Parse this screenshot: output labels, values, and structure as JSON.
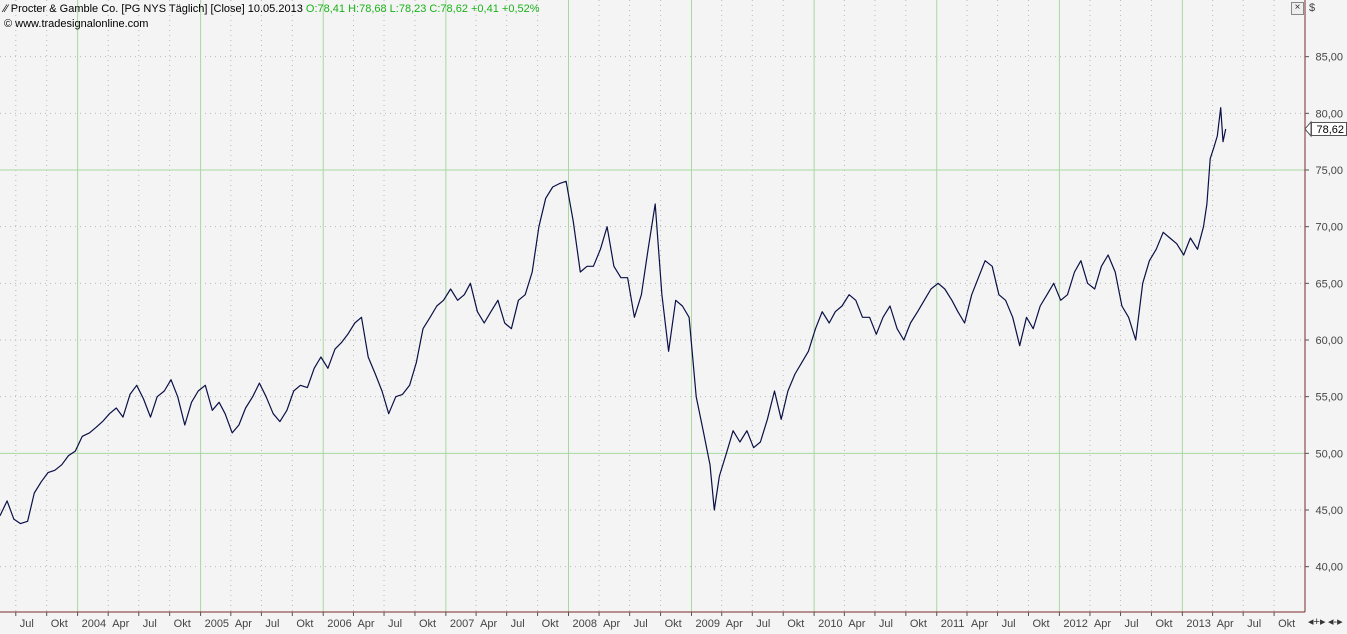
{
  "header": {
    "name": "Procter & Gamble Co.",
    "bracket": "[PG NYS  Täglich] [Close]",
    "date": "10.05.2013",
    "ohlc": "O:78,41 H:78,68 L:78,23 C:78,62 +0,41 +0,52%",
    "source": "www.tradesignalonline.com"
  },
  "close_symbol": "×",
  "nav_symbols": [
    "◂+▸",
    "◂-▸"
  ],
  "colors": {
    "line": "#0b1046",
    "grid_major": "#a8d8a0",
    "grid_minor": "#b8b8b8",
    "background": "#f4f4f4",
    "axis_text": "#444444",
    "up": "#19b219"
  },
  "chart_data": {
    "type": "line",
    "title": "",
    "xlabel": "",
    "ylabel": "$",
    "ylim": [
      36,
      90
    ],
    "yticks": [
      40,
      45,
      50,
      55,
      60,
      65,
      70,
      75,
      80,
      85
    ],
    "ytick_labels": [
      "40,00",
      "45,00",
      "50,00",
      "55,00",
      "60,00",
      "65,00",
      "70,00",
      "75,00",
      "80,00",
      "85,00"
    ],
    "xlim": [
      "2003-05-15",
      "2014-01-01"
    ],
    "xticks": [
      {
        "date": "2003-07-01",
        "label": "Jul"
      },
      {
        "date": "2003-10-01",
        "label": "Okt"
      },
      {
        "date": "2004-01-01",
        "label": "2004",
        "major": true
      },
      {
        "date": "2004-04-01",
        "label": "Apr"
      },
      {
        "date": "2004-07-01",
        "label": "Jul"
      },
      {
        "date": "2004-10-01",
        "label": "Okt"
      },
      {
        "date": "2005-01-01",
        "label": "2005",
        "major": true
      },
      {
        "date": "2005-04-01",
        "label": "Apr"
      },
      {
        "date": "2005-07-01",
        "label": "Jul"
      },
      {
        "date": "2005-10-01",
        "label": "Okt"
      },
      {
        "date": "2006-01-01",
        "label": "2006",
        "major": true
      },
      {
        "date": "2006-04-01",
        "label": "Apr"
      },
      {
        "date": "2006-07-01",
        "label": "Jul"
      },
      {
        "date": "2006-10-01",
        "label": "Okt"
      },
      {
        "date": "2007-01-01",
        "label": "2007",
        "major": true
      },
      {
        "date": "2007-04-01",
        "label": "Apr"
      },
      {
        "date": "2007-07-01",
        "label": "Jul"
      },
      {
        "date": "2007-10-01",
        "label": "Okt"
      },
      {
        "date": "2008-01-01",
        "label": "2008",
        "major": true
      },
      {
        "date": "2008-04-01",
        "label": "Apr"
      },
      {
        "date": "2008-07-01",
        "label": "Jul"
      },
      {
        "date": "2008-10-01",
        "label": "Okt"
      },
      {
        "date": "2009-01-01",
        "label": "2009",
        "major": true
      },
      {
        "date": "2009-04-01",
        "label": "Apr"
      },
      {
        "date": "2009-07-01",
        "label": "Jul"
      },
      {
        "date": "2009-10-01",
        "label": "Okt"
      },
      {
        "date": "2010-01-01",
        "label": "2010",
        "major": true
      },
      {
        "date": "2010-04-01",
        "label": "Apr"
      },
      {
        "date": "2010-07-01",
        "label": "Jul"
      },
      {
        "date": "2010-10-01",
        "label": "Okt"
      },
      {
        "date": "2011-01-01",
        "label": "2011",
        "major": true
      },
      {
        "date": "2011-04-01",
        "label": "Apr"
      },
      {
        "date": "2011-07-01",
        "label": "Jul"
      },
      {
        "date": "2011-10-01",
        "label": "Okt"
      },
      {
        "date": "2012-01-01",
        "label": "2012",
        "major": true
      },
      {
        "date": "2012-04-01",
        "label": "Apr"
      },
      {
        "date": "2012-07-01",
        "label": "Jul"
      },
      {
        "date": "2012-10-01",
        "label": "Okt"
      },
      {
        "date": "2013-01-01",
        "label": "2013",
        "major": true
      },
      {
        "date": "2013-04-01",
        "label": "Apr"
      },
      {
        "date": "2013-07-01",
        "label": "Jul"
      },
      {
        "date": "2013-10-01",
        "label": "Okt"
      }
    ],
    "grid": true,
    "current_value_label": "78,62",
    "series": [
      {
        "x": [
          "2003-05-15",
          "2003-06-05",
          "2003-06-25",
          "2003-07-15",
          "2003-08-05",
          "2003-08-25",
          "2003-09-15",
          "2003-10-05",
          "2003-10-25",
          "2003-11-15",
          "2003-12-05",
          "2003-12-25",
          "2004-01-15",
          "2004-02-05",
          "2004-02-25",
          "2004-03-15",
          "2004-04-05",
          "2004-04-25",
          "2004-05-15",
          "2004-06-05",
          "2004-06-25",
          "2004-07-15",
          "2004-08-05",
          "2004-08-25",
          "2004-09-15",
          "2004-10-05",
          "2004-10-25",
          "2004-11-15",
          "2004-12-05",
          "2004-12-25",
          "2005-01-15",
          "2005-02-05",
          "2005-02-25",
          "2005-03-15",
          "2005-04-05",
          "2005-04-25",
          "2005-05-15",
          "2005-06-05",
          "2005-06-25",
          "2005-07-15",
          "2005-08-05",
          "2005-08-25",
          "2005-09-15",
          "2005-10-05",
          "2005-10-25",
          "2005-11-15",
          "2005-12-05",
          "2005-12-25",
          "2006-01-15",
          "2006-02-05",
          "2006-02-25",
          "2006-03-15",
          "2006-04-05",
          "2006-04-25",
          "2006-05-15",
          "2006-06-05",
          "2006-06-25",
          "2006-07-15",
          "2006-08-05",
          "2006-08-25",
          "2006-09-15",
          "2006-10-05",
          "2006-10-25",
          "2006-11-15",
          "2006-12-05",
          "2006-12-25",
          "2007-01-15",
          "2007-02-05",
          "2007-02-25",
          "2007-03-15",
          "2007-04-05",
          "2007-04-25",
          "2007-05-15",
          "2007-06-05",
          "2007-06-25",
          "2007-07-15",
          "2007-08-05",
          "2007-08-25",
          "2007-09-15",
          "2007-10-05",
          "2007-10-25",
          "2007-11-15",
          "2007-12-05",
          "2007-12-25",
          "2008-01-15",
          "2008-02-05",
          "2008-02-25",
          "2008-03-15",
          "2008-04-05",
          "2008-04-25",
          "2008-05-15",
          "2008-06-05",
          "2008-06-25",
          "2008-07-15",
          "2008-08-05",
          "2008-08-25",
          "2008-09-15",
          "2008-10-05",
          "2008-10-25",
          "2008-11-15",
          "2008-12-05",
          "2008-12-25",
          "2009-01-15",
          "2009-02-05",
          "2009-02-25",
          "2009-03-10",
          "2009-03-25",
          "2009-04-15",
          "2009-05-05",
          "2009-05-25",
          "2009-06-15",
          "2009-07-05",
          "2009-07-25",
          "2009-08-15",
          "2009-09-05",
          "2009-09-25",
          "2009-10-15",
          "2009-11-05",
          "2009-11-25",
          "2009-12-15",
          "2010-01-05",
          "2010-01-25",
          "2010-02-15",
          "2010-03-05",
          "2010-03-25",
          "2010-04-15",
          "2010-05-05",
          "2010-05-25",
          "2010-06-15",
          "2010-07-05",
          "2010-07-25",
          "2010-08-15",
          "2010-09-05",
          "2010-09-25",
          "2010-10-15",
          "2010-11-05",
          "2010-11-25",
          "2010-12-15",
          "2011-01-05",
          "2011-01-25",
          "2011-02-15",
          "2011-03-05",
          "2011-03-25",
          "2011-04-15",
          "2011-05-05",
          "2011-05-25",
          "2011-06-15",
          "2011-07-05",
          "2011-07-25",
          "2011-08-15",
          "2011-09-05",
          "2011-09-25",
          "2011-10-15",
          "2011-11-05",
          "2011-11-25",
          "2011-12-15",
          "2012-01-05",
          "2012-01-25",
          "2012-02-15",
          "2012-03-05",
          "2012-03-25",
          "2012-04-15",
          "2012-05-05",
          "2012-05-25",
          "2012-06-15",
          "2012-07-05",
          "2012-07-25",
          "2012-08-15",
          "2012-09-05",
          "2012-09-25",
          "2012-10-15",
          "2012-11-05",
          "2012-11-25",
          "2012-12-15",
          "2013-01-05",
          "2013-01-25",
          "2013-02-15",
          "2013-03-05",
          "2013-03-15",
          "2013-03-25",
          "2013-04-05",
          "2013-04-15",
          "2013-04-25",
          "2013-05-02",
          "2013-05-10"
        ],
        "values": [
          44.5,
          45.8,
          44.2,
          43.8,
          44.0,
          46.5,
          47.5,
          48.3,
          48.5,
          49.0,
          49.8,
          50.2,
          51.5,
          51.8,
          52.3,
          52.8,
          53.5,
          54.0,
          53.2,
          55.2,
          56.0,
          54.8,
          53.2,
          55.0,
          55.5,
          56.5,
          55.0,
          52.5,
          54.5,
          55.5,
          56.0,
          53.8,
          54.5,
          53.5,
          51.8,
          52.5,
          54.0,
          55.0,
          56.2,
          55.0,
          53.5,
          52.8,
          53.8,
          55.5,
          56.0,
          55.8,
          57.5,
          58.5,
          57.5,
          59.2,
          59.8,
          60.5,
          61.5,
          62.0,
          58.5,
          57.0,
          55.5,
          53.5,
          55.0,
          55.2,
          56.0,
          58.0,
          61.0,
          62.0,
          63.0,
          63.5,
          64.5,
          63.5,
          64.0,
          65.0,
          62.5,
          61.5,
          62.5,
          63.5,
          61.5,
          61.0,
          63.5,
          64.0,
          66.0,
          70.0,
          72.5,
          73.5,
          73.8,
          74.0,
          70.5,
          66.0,
          66.5,
          66.5,
          68.0,
          70.0,
          66.5,
          65.5,
          65.5,
          62.0,
          64.0,
          68.0,
          72.0,
          64.0,
          59.0,
          63.5,
          63.0,
          62.0,
          55.0,
          52.0,
          49.0,
          45.0,
          48.0,
          50.0,
          52.0,
          51.0,
          52.0,
          50.5,
          51.0,
          53.0,
          55.5,
          53.0,
          55.5,
          57.0,
          58.0,
          59.0,
          61.0,
          62.5,
          61.5,
          62.5,
          63.0,
          64.0,
          63.5,
          62.0,
          62.0,
          60.5,
          62.0,
          63.0,
          61.0,
          60.0,
          61.5,
          62.5,
          63.5,
          64.5,
          65.0,
          64.5,
          63.5,
          62.5,
          61.5,
          64.0,
          65.5,
          67.0,
          66.5,
          64.0,
          63.5,
          62.0,
          59.5,
          62.0,
          61.0,
          63.0,
          64.0,
          65.0,
          63.5,
          64.0,
          66.0,
          67.0,
          65.0,
          64.5,
          66.5,
          67.5,
          66.0,
          63.0,
          62.0,
          60.0,
          65.0,
          67.0,
          68.0,
          69.5,
          69.0,
          68.5,
          67.5,
          69.0,
          68.0,
          70.0,
          72.0,
          76.0,
          77.0,
          78.0,
          80.5,
          77.5,
          78.62
        ]
      }
    ]
  }
}
